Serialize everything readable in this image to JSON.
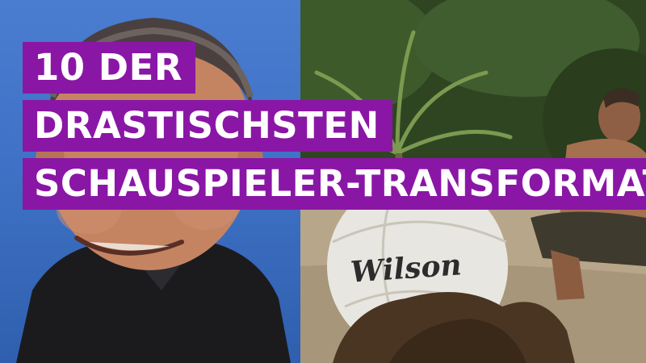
{
  "title": {
    "line1": "10 DER",
    "line2": "DRASTISCHSTEN",
    "line3": "SCHAUSPIELER-TRANSFORMATIONEN"
  },
  "colors": {
    "title_band": "#8a16a6",
    "left_background": "#3f72c6",
    "ball": "#e8e6e0"
  },
  "images": {
    "left": "portrait of actor smiling in dark jacket against blue backdrop",
    "right": "bearded man on sandy beach with palm trees and a Wilson volleyball"
  },
  "ball_logo": "Wilson"
}
